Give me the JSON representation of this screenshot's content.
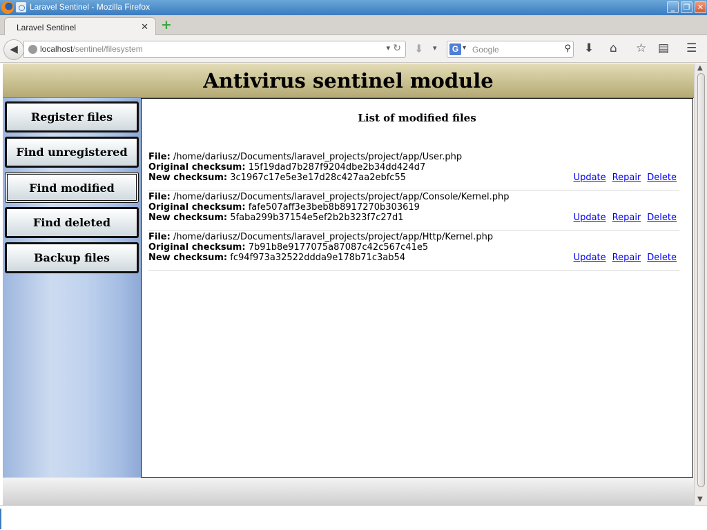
{
  "window": {
    "title": "Laravel Sentinel - Mozilla Firefox"
  },
  "tab": {
    "label": "Laravel Sentinel",
    "close_glyph": "✕",
    "new_tab_glyph": "+"
  },
  "navbar": {
    "url_host": "localhost",
    "url_path": "/sentinel/filesystem",
    "search_placeholder": "Google",
    "search_engine_icon": "G"
  },
  "page": {
    "header_title": "Antivirus sentinel module",
    "sidebar": {
      "items": [
        {
          "label": "Register files"
        },
        {
          "label": "Find unregistered"
        },
        {
          "label": "Find modified"
        },
        {
          "label": "Find deleted"
        },
        {
          "label": "Backup files"
        }
      ]
    },
    "content": {
      "heading": "List of modified files",
      "field_labels": {
        "file": "File:",
        "original": "Original checksum:",
        "new": "New checksum:"
      },
      "action_labels": {
        "update": "Update",
        "repair": "Repair",
        "delete": "Delete"
      },
      "entries": [
        {
          "file": "/home/dariusz/Documents/laravel_projects/project/app/User.php",
          "original_checksum": "15f19dad7b287f9204dbe2b34dd424d7",
          "new_checksum": "3c1967c17e5e3e17d28c427aa2ebfc55"
        },
        {
          "file": "/home/dariusz/Documents/laravel_projects/project/app/Console/Kernel.php",
          "original_checksum": "fafe507aff3e3beb8b8917270b303619",
          "new_checksum": "5faba299b37154e5ef2b2b323f7c27d1"
        },
        {
          "file": "/home/dariusz/Documents/laravel_projects/project/app/Http/Kernel.php",
          "original_checksum": "7b91b8e9177075a87087c42c567c41e5",
          "new_checksum": "fc94f973a32522ddda9e178b71c3ab54"
        }
      ]
    }
  }
}
